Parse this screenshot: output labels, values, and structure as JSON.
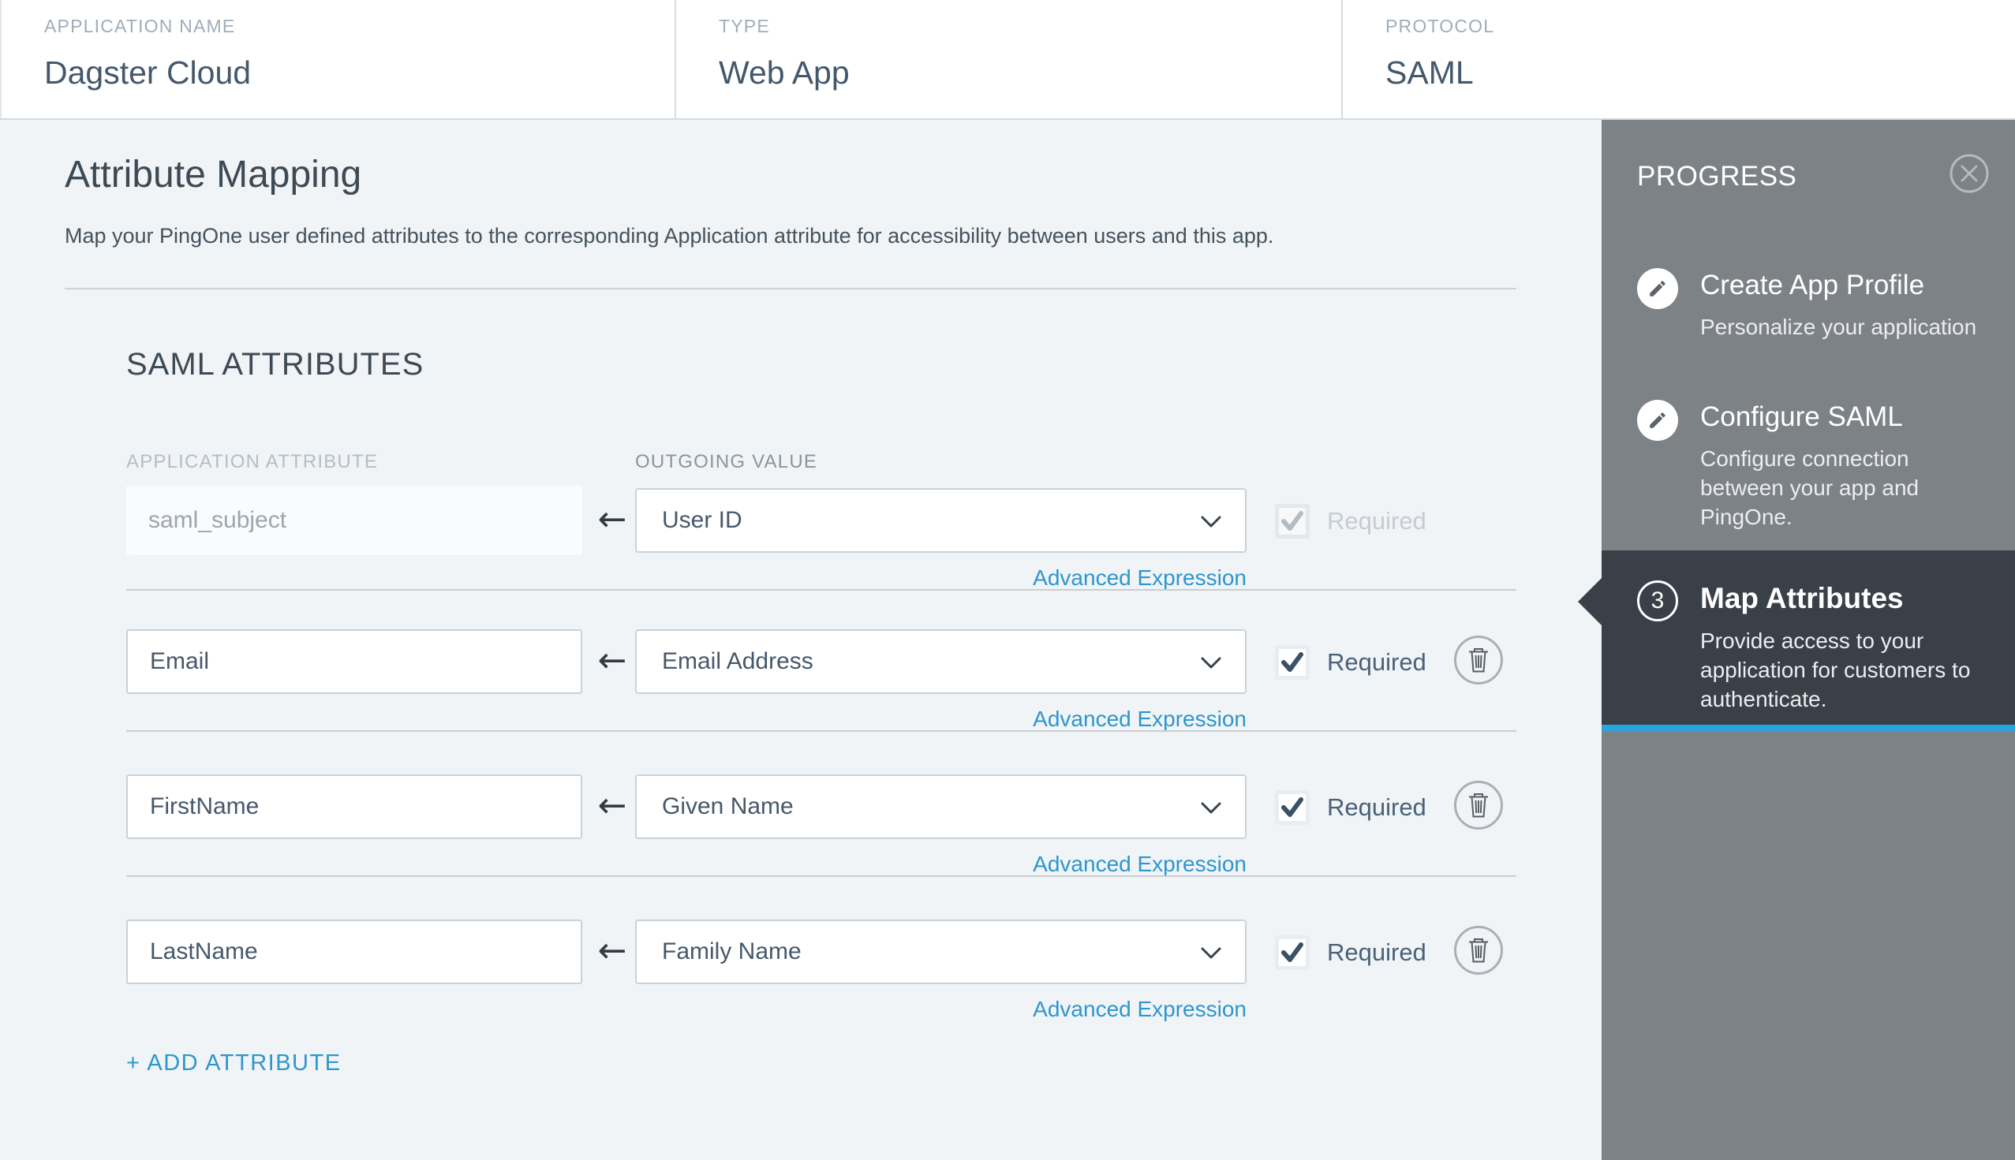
{
  "header": {
    "columns": [
      {
        "label": "APPLICATION NAME",
        "value": "Dagster Cloud"
      },
      {
        "label": "TYPE",
        "value": "Web App"
      },
      {
        "label": "PROTOCOL",
        "value": "SAML"
      }
    ]
  },
  "main": {
    "title": "Attribute Mapping",
    "description": "Map your PingOne user defined attributes to the corresponding Application attribute for accessibility between users and this app.",
    "section_title": "SAML ATTRIBUTES",
    "column_headers": {
      "application_attribute": "APPLICATION ATTRIBUTE",
      "outgoing_value": "OUTGOING VALUE"
    },
    "advanced_expression_label": "Advanced Expression",
    "required_label": "Required",
    "add_attribute_label": "+ ADD ATTRIBUTE",
    "arrow_glyph": "←",
    "rows": [
      {
        "application_attribute": "saml_subject",
        "outgoing_value": "User ID",
        "required": true,
        "locked": true,
        "deletable": false
      },
      {
        "application_attribute": "Email",
        "outgoing_value": "Email Address",
        "required": true,
        "locked": false,
        "deletable": true
      },
      {
        "application_attribute": "FirstName",
        "outgoing_value": "Given Name",
        "required": true,
        "locked": false,
        "deletable": true
      },
      {
        "application_attribute": "LastName",
        "outgoing_value": "Family Name",
        "required": true,
        "locked": false,
        "deletable": true
      }
    ]
  },
  "progress_panel": {
    "title": "PROGRESS",
    "steps": [
      {
        "title": "Create App Profile",
        "description": "Personalize your application",
        "icon": "pencil",
        "active": false
      },
      {
        "title": "Configure SAML",
        "description": "Configure connection between your app and PingOne.",
        "icon": "pencil",
        "active": false
      },
      {
        "title": "Map Attributes",
        "number": "3",
        "description": "Provide access to your application for customers to authenticate.",
        "icon": "step-number",
        "active": true
      }
    ]
  },
  "colors": {
    "accent_blue": "#2d96cc",
    "active_step_underline": "#2ba3dc",
    "sidebar_gray": "#7d8287",
    "active_step_bg": "#394047",
    "check_dark": "#3a5169",
    "check_disabled": "#b4bcc3"
  }
}
